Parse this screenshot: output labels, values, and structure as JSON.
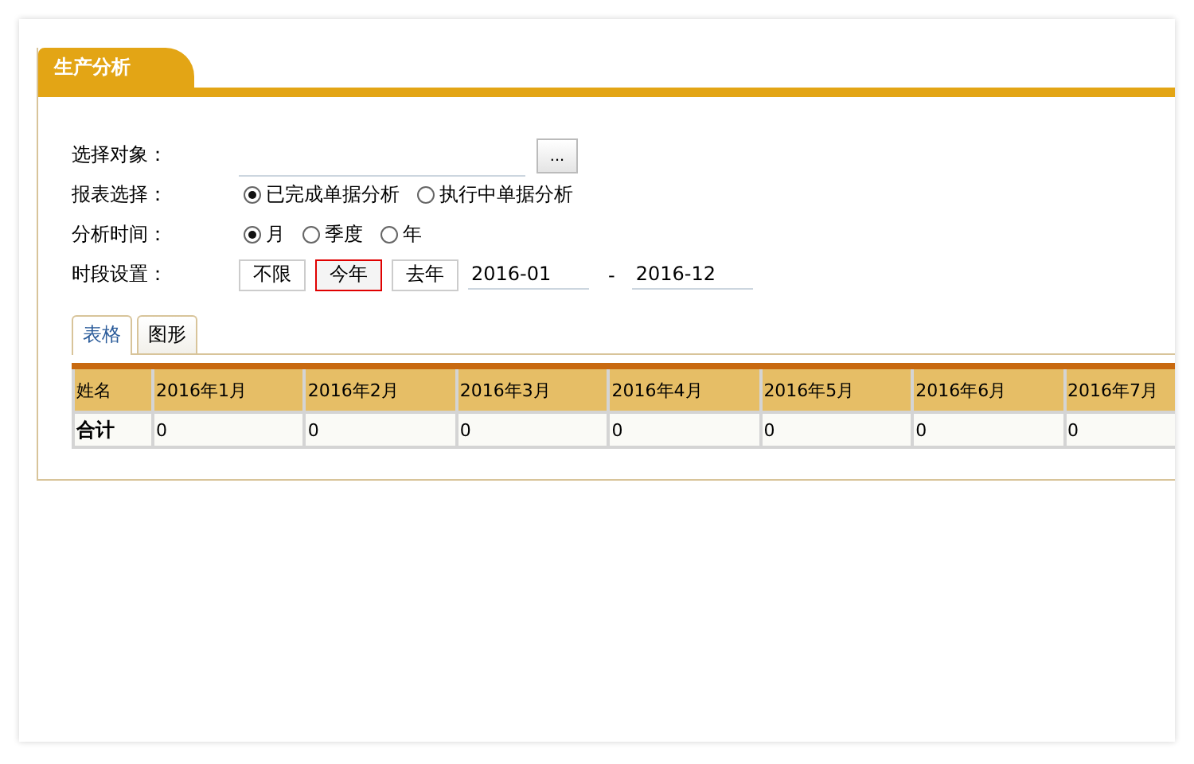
{
  "panel": {
    "title": "生产分析"
  },
  "form": {
    "target": {
      "label": "选择对象：",
      "button": "..."
    },
    "report": {
      "label": "报表选择：",
      "options": [
        {
          "label": "已完成单据分析",
          "selected": true
        },
        {
          "label": "执行中单据分析",
          "selected": false
        }
      ]
    },
    "period": {
      "label": "分析时间：",
      "options": [
        {
          "label": "月",
          "selected": true
        },
        {
          "label": "季度",
          "selected": false
        },
        {
          "label": "年",
          "selected": false
        }
      ]
    },
    "range": {
      "label": "时段设置：",
      "presets": [
        {
          "label": "不限",
          "selected": false
        },
        {
          "label": "今年",
          "selected": true
        },
        {
          "label": "去年",
          "selected": false
        }
      ],
      "from": "2016-01",
      "separator": "-",
      "to": "2016-12"
    }
  },
  "tabs": [
    {
      "label": "表格",
      "selected": true
    },
    {
      "label": "图形",
      "selected": false
    }
  ],
  "table": {
    "columns": [
      "姓名",
      "2016年1月",
      "2016年2月",
      "2016年3月",
      "2016年4月",
      "2016年5月",
      "2016年6月",
      "2016年7月"
    ],
    "rows": [
      [
        "合计",
        "0",
        "0",
        "0",
        "0",
        "0",
        "0",
        "0"
      ]
    ]
  }
}
